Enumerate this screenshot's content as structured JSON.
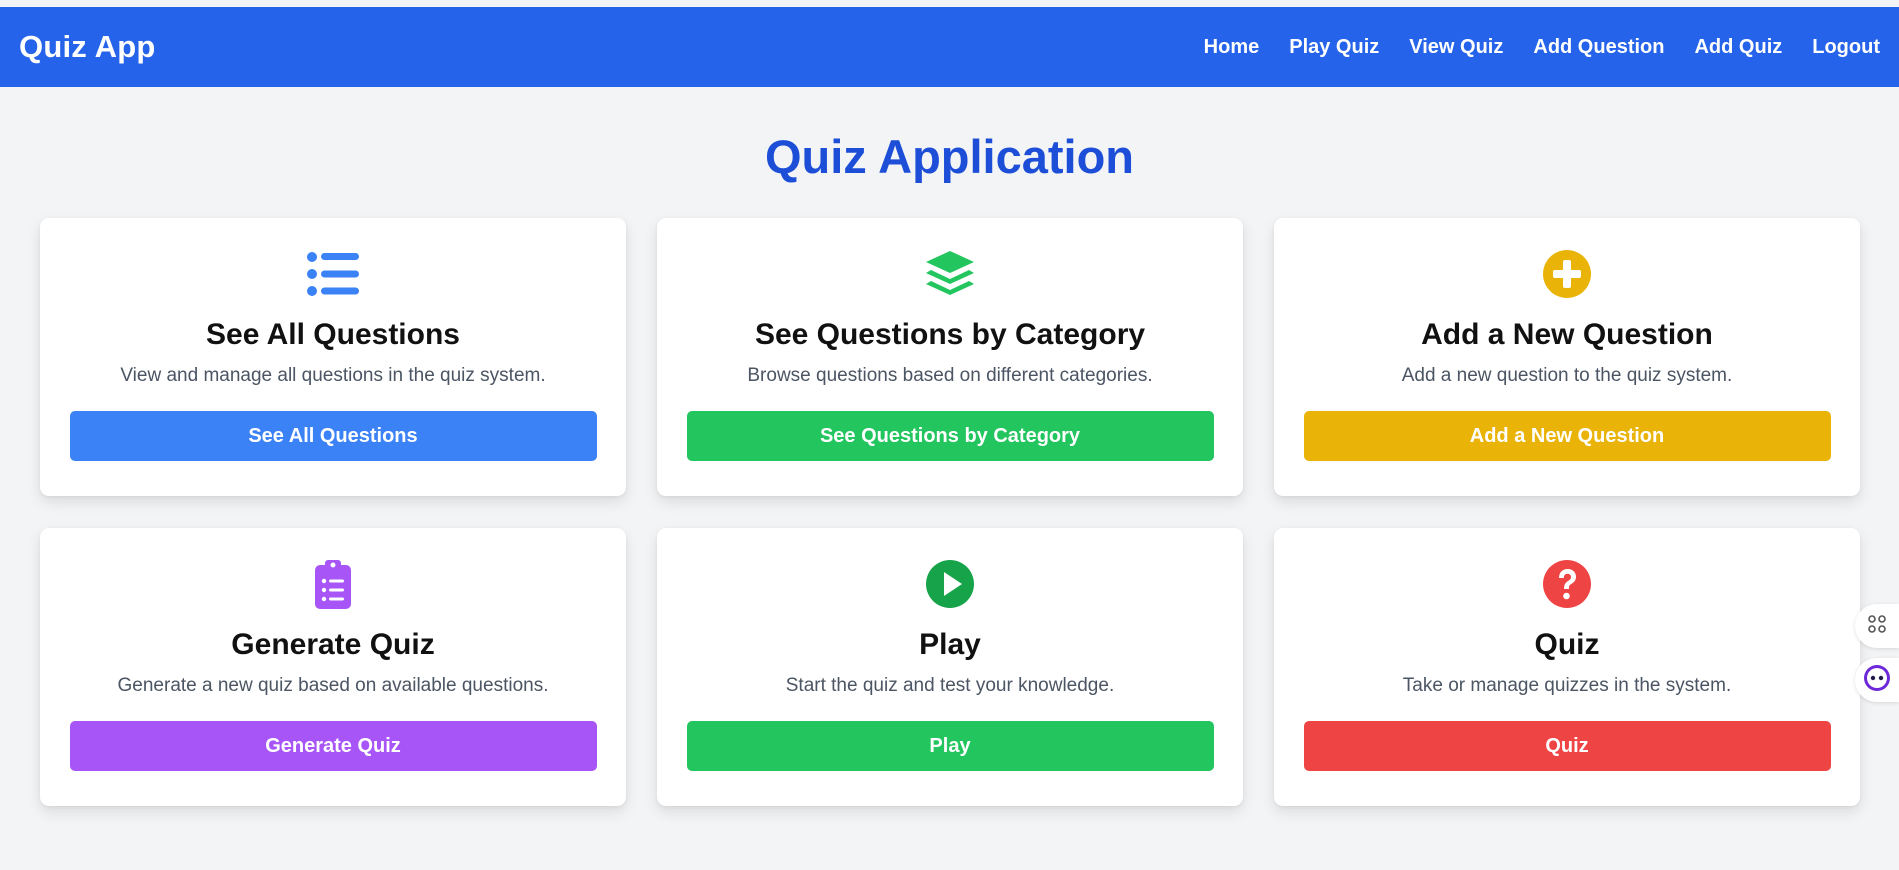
{
  "navbar": {
    "brand": "Quiz App",
    "links": [
      "Home",
      "Play Quiz",
      "View Quiz",
      "Add Question",
      "Add Quiz",
      "Logout"
    ]
  },
  "page_title": "Quiz Application",
  "cards": [
    {
      "icon": "list-icon",
      "color": "#3b82f6",
      "title": "See All Questions",
      "description": "View and manage all questions in the quiz system.",
      "button": "See All Questions"
    },
    {
      "icon": "layers-icon",
      "color": "#22c55e",
      "title": "See Questions by Category",
      "description": "Browse questions based on different categories.",
      "button": "See Questions by Category"
    },
    {
      "icon": "plus-circle-icon",
      "color": "#eab308",
      "title": "Add a New Question",
      "description": "Add a new question to the quiz system.",
      "button": "Add a New Question"
    },
    {
      "icon": "clipboard-list-icon",
      "color": "#a855f7",
      "title": "Generate Quiz",
      "description": "Generate a new quiz based on available questions.",
      "button": "Generate Quiz"
    },
    {
      "icon": "play-circle-icon",
      "color": "#22c55e",
      "title": "Play",
      "description": "Start the quiz and test your knowledge.",
      "button": "Play"
    },
    {
      "icon": "question-circle-icon",
      "color": "#ef4444",
      "title": "Quiz",
      "description": "Take or manage quizzes in the system.",
      "button": "Quiz"
    }
  ],
  "colors": {
    "navbar": "#2563eb",
    "title": "#1d4ed8",
    "background": "#f3f4f6"
  },
  "floating": [
    "apps-icon",
    "assistant-icon"
  ]
}
